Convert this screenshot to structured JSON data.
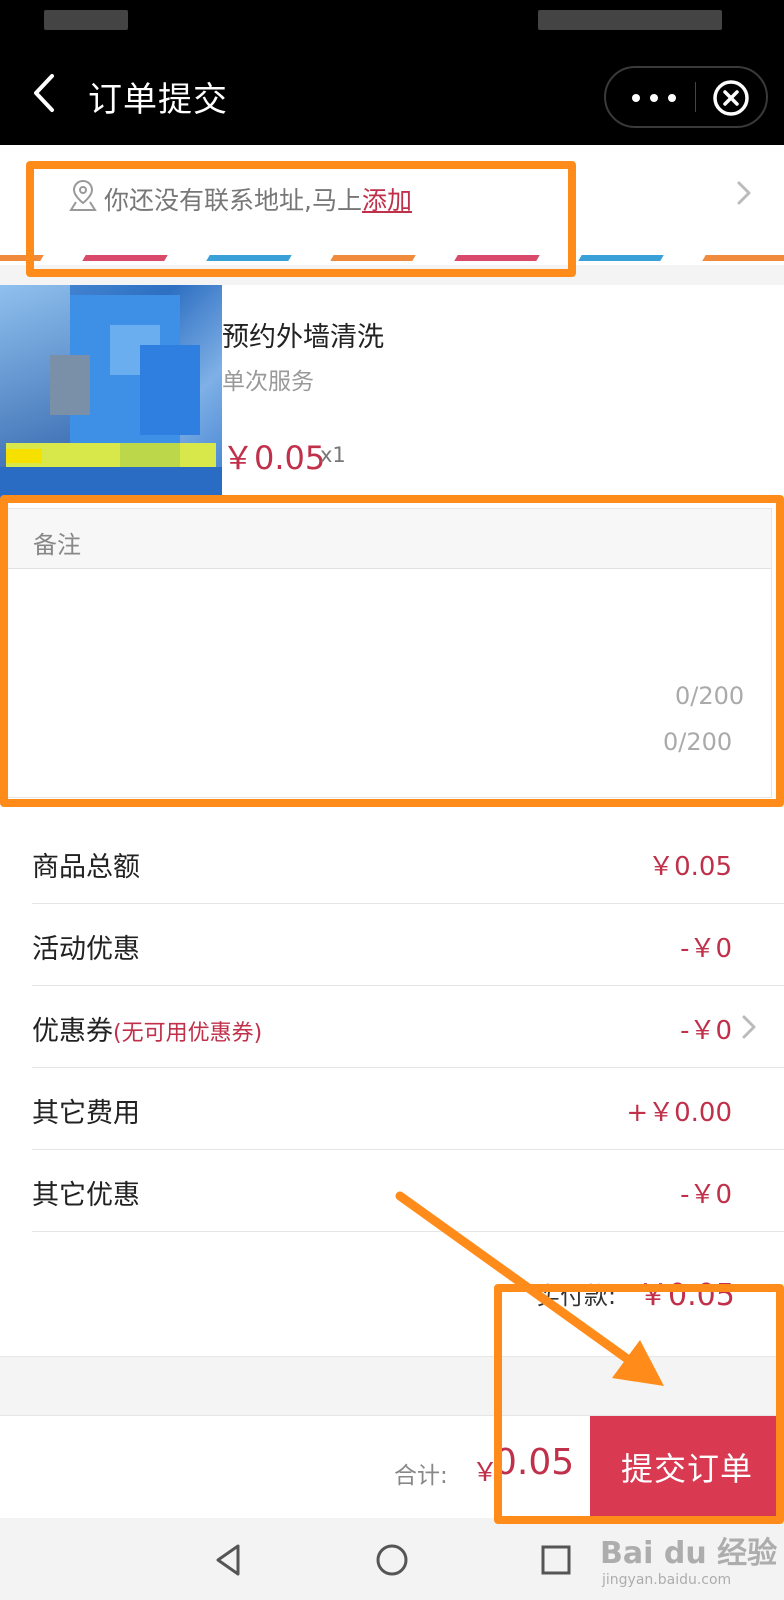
{
  "nav": {
    "title": "订单提交"
  },
  "address": {
    "prompt": "你还没有联系地址,马上",
    "link": "添加"
  },
  "product": {
    "name": "预约外墙清洗",
    "type": "单次服务",
    "price": "￥0.05",
    "qty": "x1"
  },
  "remark": {
    "label": "备注",
    "counter_inner": "0/200",
    "counter_outer": "0/200"
  },
  "fees": [
    {
      "label": "商品总额",
      "sub": "",
      "value": "￥0.05"
    },
    {
      "label": "活动优惠",
      "sub": "",
      "value": "-￥0"
    },
    {
      "label": "优惠券",
      "sub": "(无可用优惠券)",
      "value": "-￥0"
    },
    {
      "label": "其它费用",
      "sub": "",
      "value": "+￥0.00"
    },
    {
      "label": "其它优惠",
      "sub": "",
      "value": "-￥0"
    }
  ],
  "payable": {
    "label": "实付款:",
    "value": "￥0.05"
  },
  "footer": {
    "total_label": "合计:",
    "total_currency": "￥",
    "total_value": "0.05",
    "submit": "提交订单"
  },
  "watermark": {
    "brand": "Bai du 经验",
    "sub": "jingyan.baidu.com"
  },
  "colors": {
    "accent": "#d93a52",
    "price": "#c0304a",
    "annotation": "#ff8c1a"
  },
  "icons": [
    "back-arrow-icon",
    "more-dots-icon",
    "close-circle-icon",
    "location-pin-icon",
    "chevron-right-icon",
    "triangle-back-icon",
    "circle-home-icon",
    "square-recent-icon"
  ]
}
